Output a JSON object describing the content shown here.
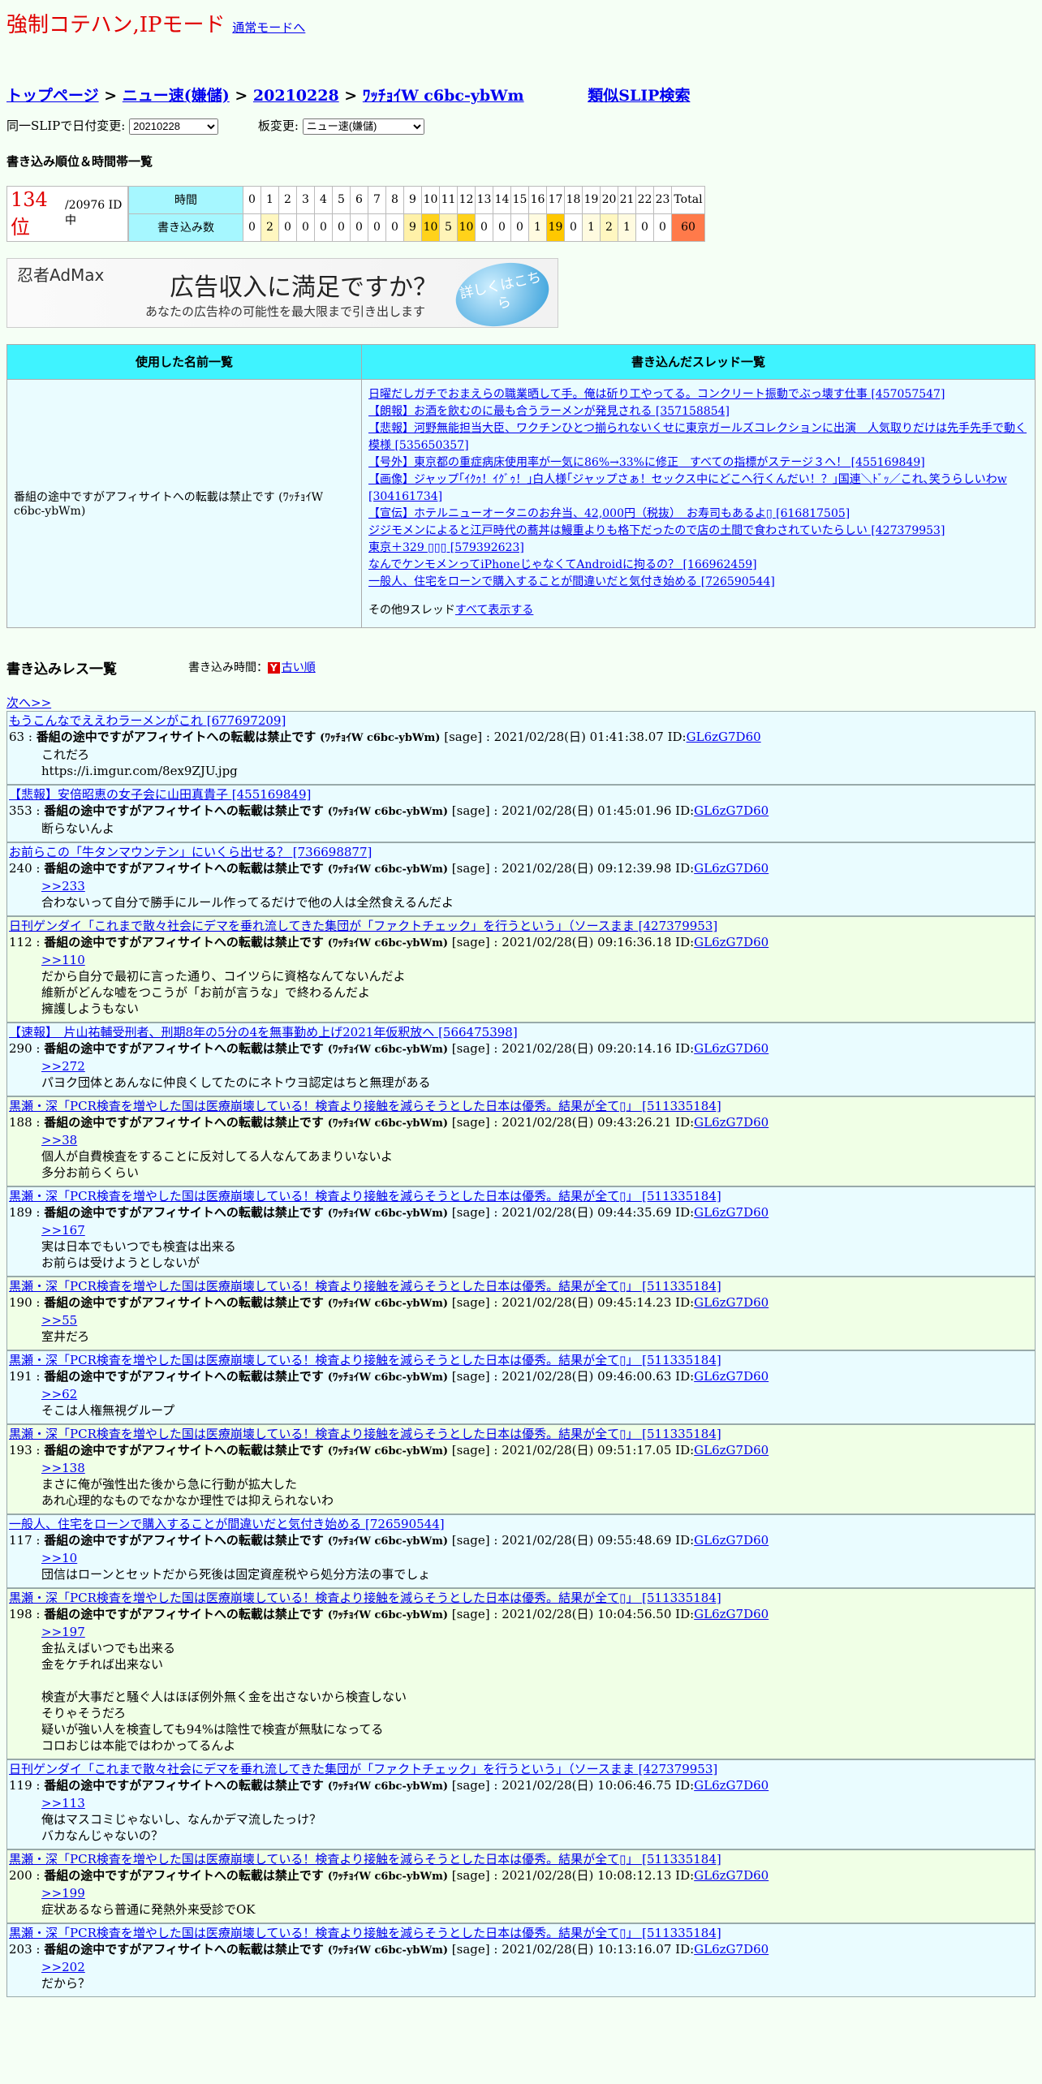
{
  "header": {
    "title": "強制コテハン,IPモード",
    "normal_link": "通常モードへ"
  },
  "breadcrumb": {
    "top": "トップページ",
    "sep": " > ",
    "board": "ニュー速(嫌儲)",
    "date": "20210228",
    "current": "ﾜｯﾁｮｲW c6bc-ybWm",
    "similar": "類似SLIP検索"
  },
  "selectors": {
    "date_label": "同一SLIPで日付変更:",
    "date_value": "20210228",
    "board_label": "板変更:",
    "board_value": "ニュー速(嫌儲)"
  },
  "rank": {
    "heading": "書き込み順位＆時間帯一覧",
    "rank": "134 位",
    "total": "/20976 ID中",
    "row_time": "時間",
    "row_count": "書き込み数",
    "total_label": "Total",
    "total_count": "60",
    "hours": [
      "0",
      "1",
      "2",
      "3",
      "4",
      "5",
      "6",
      "7",
      "8",
      "9",
      "10",
      "11",
      "12",
      "13",
      "14",
      "15",
      "16",
      "17",
      "18",
      "19",
      "20",
      "21",
      "22",
      "23"
    ],
    "counts": [
      "0",
      "2",
      "0",
      "0",
      "0",
      "0",
      "0",
      "0",
      "0",
      "9",
      "10",
      "5",
      "10",
      "0",
      "0",
      "0",
      "1",
      "19",
      "0",
      "1",
      "2",
      "1",
      "0",
      "0"
    ],
    "colors": [
      "#ffffff",
      "#fff7c0",
      "#ffffff",
      "#ffffff",
      "#ffffff",
      "#ffffff",
      "#ffffff",
      "#ffffff",
      "#ffffff",
      "#fff1a8",
      "#ffd21a",
      "#fff4b8",
      "#ffd21a",
      "#ffffff",
      "#ffffff",
      "#ffffff",
      "#fffbe0",
      "#ffc800",
      "#ffffff",
      "#fffbe0",
      "#fff7c0",
      "#fffbe0",
      "#ffffff",
      "#ffffff"
    ],
    "total_color": "#ff7a4a"
  },
  "ad": {
    "logo": "忍者AdMax",
    "line1": "広告収入に満足ですか？",
    "line2": "あなたの広告枠の可能性を最大限まで引き出します",
    "button": "詳しくはこちら"
  },
  "names": {
    "col1": "使用した名前一覧",
    "col2": "書き込んだスレッド一覧",
    "name": "番組の途中ですがアフィサイトへの転載は禁止です (ﾜｯﾁｮｲW c6bc-ybWm)",
    "threads": [
      "日曜だしガチでおまえらの職業晒して手。俺は斫り工やってる。コンクリート振動でぶっ壊す仕事 [457057547]",
      "【朗報】お酒を飲むのに最も合うラーメンが発見される [357158854]",
      "【悲報】河野無能担当大臣、ワクチンひとつ揃られないくせに東京ガールズコレクションに出演　人気取りだけは先手先手で動く模様 [535650357]",
      "【号外】東京都の重症病床使用率が一気に86%→33%に修正　すべての指標がステージ３へ！ [455169849]",
      "【画像】ジャップ｢ｲｸｩ！ｲｸﾞｩ！｣白人様｢ジャップさぁ！セックス中にどこへ行くんだい！？｣国連＼ﾄﾞｯ／これ､笑うらしいわw [304161734]",
      "【宣伝】ホテルニューオータニのお弁当、42,000円（税抜）　お寿司もあるよ▯ [616817505]",
      "ジジモメンによると江戸時代の蕎丼は鰻重よりも格下だったので店の土間で食わされていたらしい [427379953]",
      "東京＋329 ▯▯▯ [579392623]",
      "なんでケンモメンってiPhoneじゃなくてAndroidに拘るの？ [166962459]",
      "一般人、住宅をローンで購入することが間違いだと気付き始める [726590544]"
    ],
    "more_text": "その他9スレッド",
    "more_link": "すべて表示する"
  },
  "res": {
    "heading": "書き込みレス一覧",
    "order_label": "書き込み時間：",
    "order_badge": "Y",
    "order_link": "古い順",
    "next": "次へ>>"
  },
  "posts": [
    {
      "bg": "b",
      "thread": "もうこんなでええわラーメンがこれ [677697209]",
      "no": "63",
      "time": "2021/02/28(日) 01:41:38.07",
      "id": "GL6zG7D60",
      "anchor": "",
      "body": "これだろ\nhttps://i.imgur.com/8ex9ZJU.jpg"
    },
    {
      "bg": "b",
      "thread": "【悲報】安倍昭恵の女子会に山田真貴子 [455169849]",
      "no": "353",
      "time": "2021/02/28(日) 01:45:01.96",
      "id": "GL6zG7D60",
      "anchor": "",
      "body": "断らないんよ"
    },
    {
      "bg": "b",
      "thread": "お前らこの「牛タンマウンテン」にいくら出せる？ [736698877]",
      "no": "240",
      "time": "2021/02/28(日) 09:12:39.98",
      "id": "GL6zG7D60",
      "anchor": ">>233",
      "body": "合わないって自分で勝手にルール作ってるだけで他の人は全然食えるんだよ"
    },
    {
      "bg": "g",
      "thread": "日刊ゲンダイ「これまで散々社会にデマを垂れ流してきた集団が「ファクトチェック」を行うという」（ソースまま [427379953]",
      "no": "112",
      "time": "2021/02/28(日) 09:16:36.18",
      "id": "GL6zG7D60",
      "anchor": ">>110",
      "body": "だから自分で最初に言った通り、コイツらに資格なんてないんだよ\n維新がどんな嘘をつこうが「お前が言うな」で終わるんだよ\n擁護しようもない"
    },
    {
      "bg": "b",
      "thread": "【速報】　片山祐輔受刑者、刑期8年の5分の4を無事勤め上げ2021年仮釈放へ [566475398]",
      "no": "290",
      "time": "2021/02/28(日) 09:20:14.16",
      "id": "GL6zG7D60",
      "anchor": ">>272",
      "body": "パヨク団体とあんなに仲良くしてたのにネトウヨ認定はちと無理がある"
    },
    {
      "bg": "g",
      "thread": "黒瀬・深「PCR検査を増やした国は医療崩壊している！検査より接触を減らそうとした日本は優秀。結果が全て▯」 [511335184]",
      "no": "188",
      "time": "2021/02/28(日) 09:43:26.21",
      "id": "GL6zG7D60",
      "anchor": ">>38",
      "body": "個人が自費検査をすることに反対してる人なんてあまりいないよ\n多分お前らくらい"
    },
    {
      "bg": "b",
      "thread": "黒瀬・深「PCR検査を増やした国は医療崩壊している！検査より接触を減らそうとした日本は優秀。結果が全て▯」 [511335184]",
      "no": "189",
      "time": "2021/02/28(日) 09:44:35.69",
      "id": "GL6zG7D60",
      "anchor": ">>167",
      "body": "実は日本でもいつでも検査は出来る\nお前らは受けようとしないが"
    },
    {
      "bg": "g",
      "thread": "黒瀬・深「PCR検査を増やした国は医療崩壊している！検査より接触を減らそうとした日本は優秀。結果が全て▯」 [511335184]",
      "no": "190",
      "time": "2021/02/28(日) 09:45:14.23",
      "id": "GL6zG7D60",
      "anchor": ">>55",
      "body": "室井だろ"
    },
    {
      "bg": "b",
      "thread": "黒瀬・深「PCR検査を増やした国は医療崩壊している！検査より接触を減らそうとした日本は優秀。結果が全て▯」 [511335184]",
      "no": "191",
      "time": "2021/02/28(日) 09:46:00.63",
      "id": "GL6zG7D60",
      "anchor": ">>62",
      "body": "そこは人権無視グループ"
    },
    {
      "bg": "g",
      "thread": "黒瀬・深「PCR検査を増やした国は医療崩壊している！検査より接触を減らそうとした日本は優秀。結果が全て▯」 [511335184]",
      "no": "193",
      "time": "2021/02/28(日) 09:51:17.05",
      "id": "GL6zG7D60",
      "anchor": ">>138",
      "body": "まさに俺が強性出た後から急に行動が拡大した\nあれ心理的なものでなかなか理性では抑えられないわ"
    },
    {
      "bg": "b",
      "thread": "一般人、住宅をローンで購入することが間違いだと気付き始める [726590544]",
      "no": "117",
      "time": "2021/02/28(日) 09:55:48.69",
      "id": "GL6zG7D60",
      "anchor": ">>10",
      "body": "団信はローンとセットだから死後は固定資産税やら処分方法の事でしょ"
    },
    {
      "bg": "g",
      "thread": "黒瀬・深「PCR検査を増やした国は医療崩壊している！検査より接触を減らそうとした日本は優秀。結果が全て▯」 [511335184]",
      "no": "198",
      "time": "2021/02/28(日) 10:04:56.50",
      "id": "GL6zG7D60",
      "anchor": ">>197",
      "body": "金払えばいつでも出来る\n金をケチれば出来ない\n\n検査が大事だと騒ぐ人はほぼ例外無く金を出さないから検査しない\nそりゃそうだろ\n疑いが強い人を検査しても94%は陰性で検査が無駄になってる\nコロおじは本能ではわかってるんよ"
    },
    {
      "bg": "b",
      "thread": "日刊ゲンダイ「これまで散々社会にデマを垂れ流してきた集団が「ファクトチェック」を行うという」（ソースまま [427379953]",
      "no": "119",
      "time": "2021/02/28(日) 10:06:46.75",
      "id": "GL6zG7D60",
      "anchor": ">>113",
      "body": "俺はマスコミじゃないし、なんかデマ流したっけ？\nバカなんじゃないの？"
    },
    {
      "bg": "g",
      "thread": "黒瀬・深「PCR検査を増やした国は医療崩壊している！検査より接触を減らそうとした日本は優秀。結果が全て▯」 [511335184]",
      "no": "200",
      "time": "2021/02/28(日) 10:08:12.13",
      "id": "GL6zG7D60",
      "anchor": ">>199",
      "body": "症状あるなら普通に発熱外来受診でOK"
    },
    {
      "bg": "b",
      "thread": "黒瀬・深「PCR検査を増やした国は医療崩壊している！検査より接触を減らそうとした日本は優秀。結果が全て▯」 [511335184]",
      "no": "203",
      "time": "2021/02/28(日) 10:13:16.07",
      "id": "GL6zG7D60",
      "anchor": ">>202",
      "body": "だから？"
    }
  ],
  "post_name": "番組の途中ですがアフィサイトへの転載は禁止です",
  "post_trip": "(ﾜｯﾁｮｲW c6bc-ybWm)",
  "post_sage": "[sage]",
  "post_sep": " : ",
  "post_id_label": "ID:"
}
